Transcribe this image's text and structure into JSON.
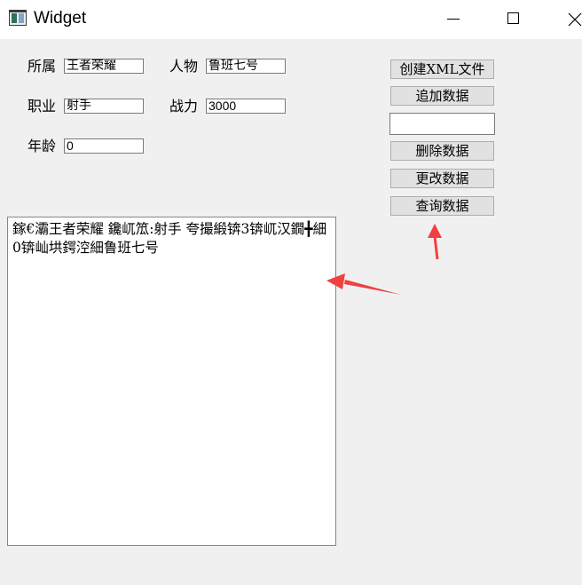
{
  "window": {
    "title": "Widget",
    "icon": "app-window-icon",
    "controls": [
      "minimize-icon",
      "maximize-icon",
      "close-icon"
    ]
  },
  "form": {
    "affiliation_label": "所属",
    "affiliation_value": "王者荣耀",
    "character_label": "人物",
    "character_value": "鲁班七号",
    "job_label": "职业",
    "job_value": "射手",
    "power_label": "战力",
    "power_value": "3000",
    "age_label": "年龄",
    "age_value": "0"
  },
  "buttons": {
    "create_xml": "创建XML文件",
    "append": "追加数据",
    "input_value": "",
    "delete": "删除数据",
    "update": "更改数据",
    "query": "查询数据"
  },
  "output": {
    "text": "鎵€灞王者荣耀 鑱屼笟:射手 夸撮緞锛3锛屼汉鐗╋細0锛屾垬鍔涳細鲁班七号"
  },
  "annotations": {
    "arrow_color": "#f04040"
  }
}
